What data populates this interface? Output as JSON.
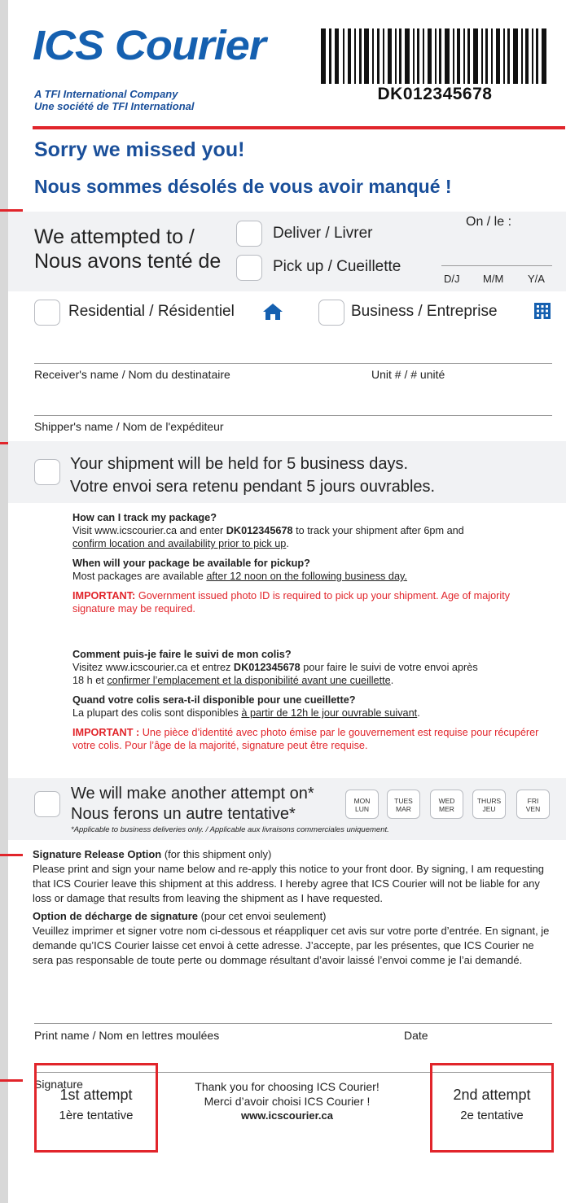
{
  "header": {
    "logo_text": "ICS Courier",
    "tagline_en": "A TFI International Company",
    "tagline_fr": "Une société de TFI International",
    "tracking_number": "DK012345678"
  },
  "title": {
    "en": "Sorry we missed you!",
    "fr": "Nous sommes désolés de vous avoir manqué !"
  },
  "attempt": {
    "line1": "We attempted to /",
    "line2": "Nous avons tenté de",
    "option_deliver": "Deliver / Livrer",
    "option_pickup": "Pick up / Cueillette",
    "on_label": "On / le :",
    "date_d": "D/J",
    "date_m": "M/M",
    "date_y": "Y/A"
  },
  "location": {
    "residential": "Residential / Résidentiel",
    "business": "Business / Entreprise"
  },
  "fields": {
    "receiver": "Receiver's name / Nom du destinataire",
    "unit": "Unit # / # unité",
    "shipper": "Shipper's name / Nom de l'expéditeur"
  },
  "held": {
    "line1": "Your shipment will be held for 5 business days.",
    "line2": "Votre envoi sera retenu pendant 5 jours ouvrables."
  },
  "info_en": {
    "q1": "How can I track my package?",
    "a1_pre": "Visit www.icscourier.ca and enter ",
    "a1_code": "DK012345678",
    "a1_post": " to track your shipment after 6pm and",
    "a1_link": "confirm location and availability prior to pick up",
    "a1_end": ".",
    "q2": "When will your package be available for pickup?",
    "a2_pre": "Most packages are available ",
    "a2_link": "after 12 noon on the following business day.",
    "imp_label": "IMPORTANT:",
    "imp_text": " Government issued photo ID is required to pick up your shipment. Age of majority signature may be required."
  },
  "info_fr": {
    "q1": "Comment puis-je faire le suivi de mon colis?",
    "a1_pre": "Visitez www.icscourier.ca et entrez ",
    "a1_code": "DK012345678",
    "a1_post": " pour faire le suivi de votre envoi après",
    "a1_line2": "18 h et ",
    "a1_link": "confirmer l’emplacement et la disponibilité avant une cueillette",
    "a1_end": ".",
    "q2": "Quand votre colis sera-t-il disponible pour une cueillette?",
    "a2_pre": "La plupart des colis sont disponibles ",
    "a2_link": "à partir de 12h le jour ouvrable suivant",
    "a2_end": ".",
    "imp_label": "IMPORTANT :",
    "imp_text": " Une pièce d’identité avec photo émise par le gouvernement est requise pour récupérer votre colis. Pour l’âge de la majorité, signature peut être requise."
  },
  "reattempt": {
    "line1": "We will make another attempt on*",
    "line2": "Nous ferons un autre tentative*",
    "note": "*Applicable to business deliveries only. / Applicable aux livraisons commerciales uniquement.",
    "days": [
      {
        "en": "MON",
        "fr": "LUN"
      },
      {
        "en": "TUES",
        "fr": "MAR"
      },
      {
        "en": "WED",
        "fr": "MER"
      },
      {
        "en": "THURS",
        "fr": "JEU"
      },
      {
        "en": "FRI",
        "fr": "VEN"
      }
    ]
  },
  "signature_release": {
    "en_title": "Signature Release Option",
    "en_sub": " (for this shipment only)",
    "en_body": "Please print and sign your name below and re-apply this notice to your front door. By signing, I am requesting that ICS Courier leave this shipment at this address. I hereby agree that ICS Courier will not be liable for any loss or damage that results from leaving the shipment as I have requested.",
    "fr_title": "Option de décharge de signature",
    "fr_sub": " (pour cet envoi seulement)",
    "fr_body": "Veuillez imprimer et signer votre nom ci-dessous et réappliquer cet avis sur votre porte d’entrée. En signant, je demande qu’ICS Courier laisse cet envoi à cette adresse. J’accepte, par les présentes, que ICS Courier ne sera pas responsable de toute perte ou dommage résultant d’avoir laissé l’envoi comme je l’ai demandé.",
    "print_name": "Print name / Nom en lettres moulées",
    "date": "Date",
    "signature": "Signature"
  },
  "footer": {
    "first_en": "1st attempt",
    "first_fr": "1ère tentative",
    "second_en": "2nd attempt",
    "second_fr": "2e tentative",
    "thanks_en": "Thank you for choosing ICS Courier!",
    "thanks_fr": "Merci d’avoir choisi ICS Courier !",
    "url": "www.icscourier.ca"
  },
  "colors": {
    "brand_blue": "#1560b0",
    "accent_red": "#e1252b",
    "panel_grey": "#f1f2f4"
  }
}
